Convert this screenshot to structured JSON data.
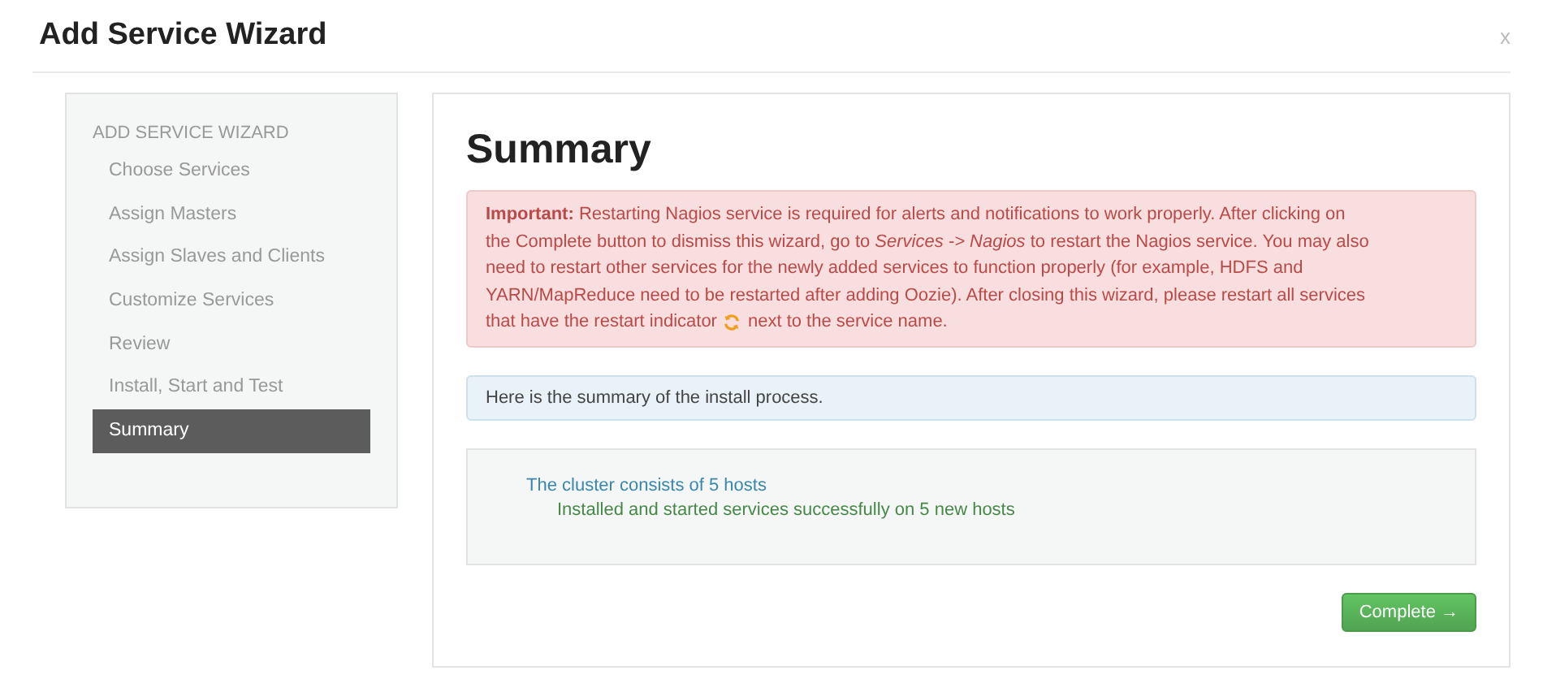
{
  "window": {
    "title": "Add Service Wizard",
    "close": "x"
  },
  "sidebar": {
    "heading": "ADD SERVICE WIZARD",
    "items": [
      {
        "label": "Choose Services",
        "selected": false
      },
      {
        "label": "Assign Masters",
        "selected": false
      },
      {
        "label": "Assign Slaves and Clients",
        "selected": false
      },
      {
        "label": "Customize Services",
        "selected": false
      },
      {
        "label": "Review",
        "selected": false
      },
      {
        "label": "Install, Start and Test",
        "selected": false
      },
      {
        "label": "Summary",
        "selected": true
      }
    ]
  },
  "content": {
    "title": "Summary",
    "warning": {
      "lines": [
        "**Important:** Restarting Nagios service is required for alerts and notifications to work properly. After clicking on",
        "the Complete button to dismiss this wizard, go to *Services -> Nagios* to restart the Nagios service. You may also",
        "need to restart other services for the newly added services to function properly (for example, HDFS and",
        "YARN/MapReduce need to be restarted after adding Oozie). After closing this wizard, please restart all services"
      ],
      "before": "that have the restart indicator",
      "after": "next to the service name."
    },
    "info": "Here is the summary of the install process.",
    "summary": {
      "cluster": "The cluster consists of 5 hosts",
      "result": "Installed and started services successfully on 5 new hosts"
    },
    "button": "Complete →"
  }
}
